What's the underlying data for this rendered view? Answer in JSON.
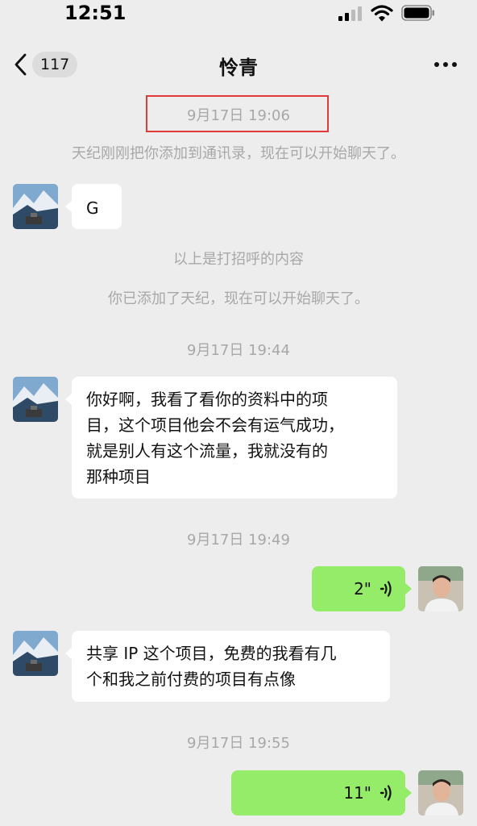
{
  "status_bar": {
    "time": "12:51"
  },
  "nav": {
    "back_badge": "117",
    "title": "怜青"
  },
  "messages": {
    "t1": "9月17日 19:06",
    "sys1": "天纪刚刚把你添加到通讯录，现在可以开始聊天了。",
    "m1": "G",
    "sys2": "以上是打招呼的内容",
    "sys3": "你已添加了天纪，现在可以开始聊天了。",
    "t2": "9月17日 19:44",
    "m2_lines": [
      "你好啊，我看了看你的资料中的项",
      "目，这个项目他会不会有运气成功，",
      "就是别人有这个流量，我就没有的",
      "那种项目"
    ],
    "t3": "9月17日 19:49",
    "voice1": "2\"",
    "m3_lines": [
      "共享 IP 这个项目，免费的我看有几",
      "个和我之前付费的项目有点像"
    ],
    "t4": "9月17日 19:55",
    "voice2": "11\""
  },
  "colors": {
    "self_bubble": "#95ec69",
    "highlight": "#e03a3a"
  },
  "icons": [
    "back-chevron-icon",
    "more-icon",
    "voice-wave-icon",
    "signal-icon",
    "wifi-icon",
    "battery-icon"
  ]
}
